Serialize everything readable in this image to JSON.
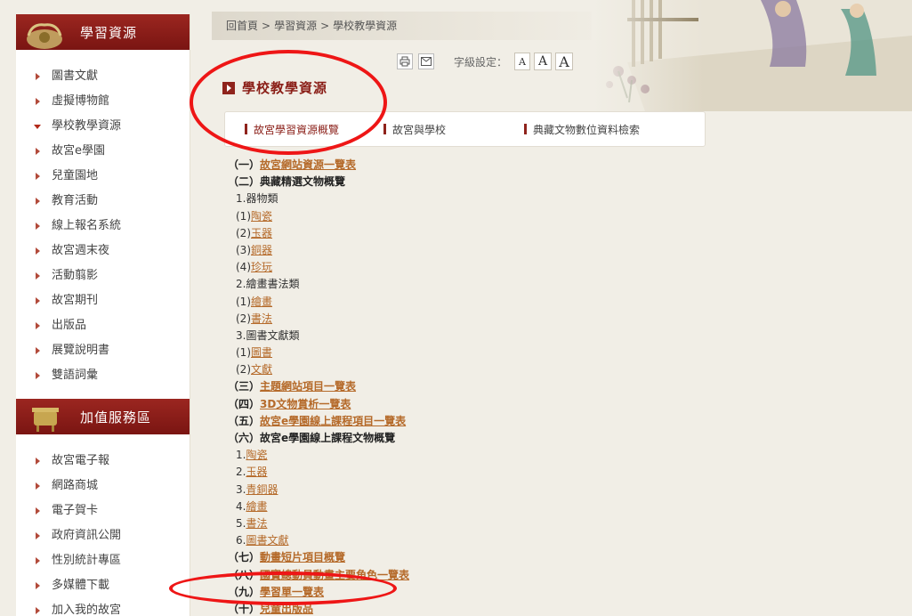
{
  "sidebar": {
    "section1_title": "學習資源",
    "items1": [
      {
        "label": "圖書文獻"
      },
      {
        "label": "虛擬博物館"
      },
      {
        "label": "學校教學資源"
      },
      {
        "label": "故宮e學園"
      },
      {
        "label": "兒童園地"
      },
      {
        "label": "教育活動"
      },
      {
        "label": "線上報名系統"
      },
      {
        "label": "故宮週末夜"
      },
      {
        "label": "活動翦影"
      },
      {
        "label": "故宮期刊"
      },
      {
        "label": "出版品"
      },
      {
        "label": "展覽說明書"
      },
      {
        "label": "雙語詞彙"
      }
    ],
    "section2_title": "加值服務區",
    "items2": [
      {
        "label": "故宮電子報"
      },
      {
        "label": "網路商城"
      },
      {
        "label": "電子賀卡"
      },
      {
        "label": "政府資訊公開"
      },
      {
        "label": "性別統計專區"
      },
      {
        "label": "多媒體下載"
      },
      {
        "label": "加入我的故宮"
      }
    ]
  },
  "breadcrumb": [
    "回首頁",
    ">",
    "學習資源",
    ">",
    "學校教學資源"
  ],
  "tools": {
    "font_label": "字級設定：",
    "font_small": "A",
    "font_medium": "A",
    "font_large": "A"
  },
  "page": {
    "title": "學校教學資源"
  },
  "tabs": [
    {
      "label": "故宮學習資源概覽"
    },
    {
      "label": "故宮與學校"
    },
    {
      "label": "典藏文物數位資料檢索"
    }
  ],
  "content": [
    {
      "prefix": "（一）",
      "text": "故宮網站資源一覽表",
      "type": "sec",
      "link": true
    },
    {
      "prefix": "（二）",
      "text": "典藏精選文物概覽",
      "type": "sec",
      "link": false
    },
    {
      "prefix": "1.",
      "text": "器物類",
      "type": "sub",
      "link": false
    },
    {
      "prefix": "(1)",
      "text": "陶瓷",
      "type": "item",
      "link": true
    },
    {
      "prefix": "(2)",
      "text": "玉器",
      "type": "item",
      "link": true
    },
    {
      "prefix": "(3)",
      "text": "銅器",
      "type": "item",
      "link": true
    },
    {
      "prefix": "(4)",
      "text": "珍玩",
      "type": "item",
      "link": true
    },
    {
      "prefix": "2.",
      "text": "繪畫書法類",
      "type": "sub",
      "link": false
    },
    {
      "prefix": "(1)",
      "text": "繪畫",
      "type": "item",
      "link": true
    },
    {
      "prefix": "(2)",
      "text": "書法",
      "type": "item",
      "link": true
    },
    {
      "prefix": "3.",
      "text": "圖書文獻類",
      "type": "sub",
      "link": false
    },
    {
      "prefix": "(1)",
      "text": "圖書",
      "type": "item",
      "link": true
    },
    {
      "prefix": "(2)",
      "text": "文獻",
      "type": "item",
      "link": true
    },
    {
      "prefix": "（三）",
      "text": "主題網站項目一覽表",
      "type": "sec",
      "link": true
    },
    {
      "prefix": "（四）",
      "text": "3D文物賞析一覽表",
      "type": "sec",
      "link": true
    },
    {
      "prefix": "（五）",
      "text": "故宮e學園線上課程項目一覽表",
      "type": "sec",
      "link": true
    },
    {
      "prefix": "（六）",
      "text": "故宮e學園線上課程文物概覽",
      "type": "sec",
      "link": false
    },
    {
      "prefix": "1.",
      "text": "陶瓷",
      "type": "item",
      "link": true
    },
    {
      "prefix": "2.",
      "text": "玉器",
      "type": "item",
      "link": true
    },
    {
      "prefix": "3.",
      "text": "青銅器",
      "type": "item",
      "link": true
    },
    {
      "prefix": "4.",
      "text": "繪畫",
      "type": "item",
      "link": true
    },
    {
      "prefix": "5.",
      "text": "書法",
      "type": "item",
      "link": true
    },
    {
      "prefix": "6.",
      "text": "圖書文獻",
      "type": "item",
      "link": true
    },
    {
      "prefix": "（七）",
      "text": "動畫短片項目概覽",
      "type": "sec",
      "link": true
    },
    {
      "prefix": "（八）",
      "text": "國寶總動員動畫主要角色一覽表",
      "type": "sec",
      "link": true
    },
    {
      "prefix": "（九）",
      "text": "學習單一覽表",
      "type": "sec",
      "link": true
    },
    {
      "prefix": "（十）",
      "text": "兒童出版品",
      "type": "sec",
      "link": true
    }
  ],
  "colors": {
    "accent": "#8a1e17",
    "link": "#b56a2a",
    "annotation": "#ee1616"
  },
  "icons": [
    "print-icon",
    "mail-icon",
    "title-arrow-icon",
    "sidebar-arrow-icon"
  ]
}
